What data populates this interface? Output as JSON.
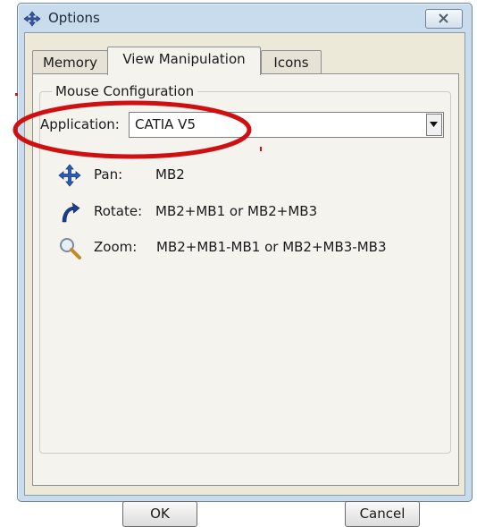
{
  "window": {
    "title": "Options",
    "close_glyph": "✕"
  },
  "tabs": [
    {
      "label": "Memory",
      "active": false
    },
    {
      "label": "View Manipulation",
      "active": true
    },
    {
      "label": "Icons",
      "active": false
    }
  ],
  "group": {
    "title": "Mouse Configuration"
  },
  "application": {
    "label": "Application:",
    "value": "CATIA V5"
  },
  "mappings": [
    {
      "icon": "pan-icon",
      "label": "Pan:",
      "value": "MB2"
    },
    {
      "icon": "rotate-icon",
      "label": "Rotate:",
      "value": "MB2+MB1 or MB2+MB3"
    },
    {
      "icon": "zoom-icon",
      "label": "Zoom:",
      "value": "MB2+MB1-MB1 or MB2+MB3-MB3"
    }
  ],
  "buttons": {
    "ok": "OK",
    "cancel": "Cancel"
  },
  "colors": {
    "annotation": "#d01010",
    "icon_blue": "#1b3f8f"
  }
}
